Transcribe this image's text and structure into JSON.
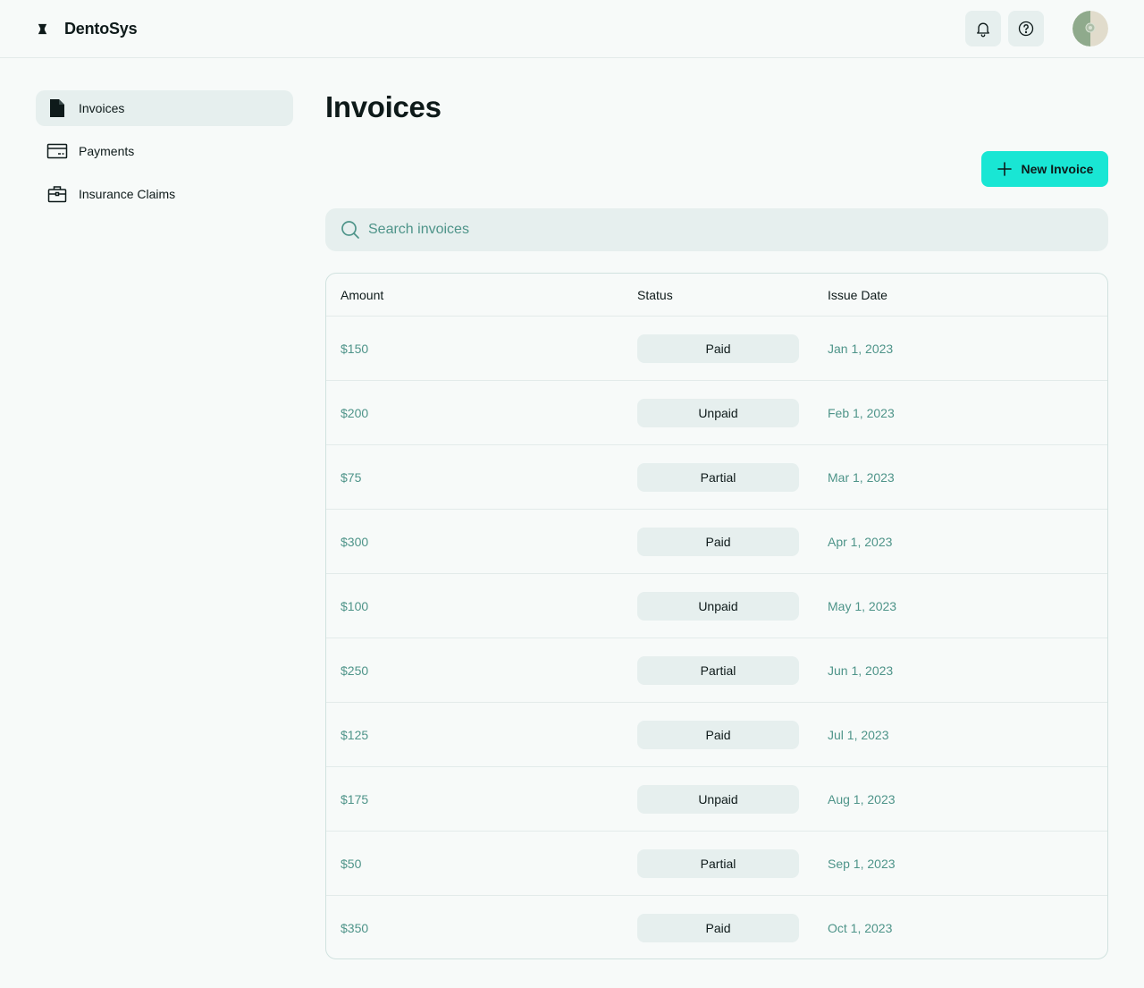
{
  "app": {
    "name": "DentoSys"
  },
  "header": {
    "icons": [
      "bell-icon",
      "help-circle-icon"
    ]
  },
  "sidebar": {
    "items": [
      {
        "label": "Invoices",
        "icon": "document-icon",
        "active": true
      },
      {
        "label": "Payments",
        "icon": "credit-card-icon",
        "active": false
      },
      {
        "label": "Insurance Claims",
        "icon": "briefcase-icon",
        "active": false
      }
    ]
  },
  "main": {
    "title": "Invoices",
    "new_button_label": "New Invoice",
    "search": {
      "placeholder": "Search invoices",
      "value": ""
    },
    "table": {
      "columns": [
        "Amount",
        "Status",
        "Issue Date"
      ],
      "rows": [
        {
          "amount": "$150",
          "status": "Paid",
          "date": "Jan 1, 2023"
        },
        {
          "amount": "$200",
          "status": "Unpaid",
          "date": "Feb 1, 2023"
        },
        {
          "amount": "$75",
          "status": "Partial",
          "date": "Mar 1, 2023"
        },
        {
          "amount": "$300",
          "status": "Paid",
          "date": "Apr 1, 2023"
        },
        {
          "amount": "$100",
          "status": "Unpaid",
          "date": "May 1, 2023"
        },
        {
          "amount": "$250",
          "status": "Partial",
          "date": "Jun 1, 2023"
        },
        {
          "amount": "$125",
          "status": "Paid",
          "date": "Jul 1, 2023"
        },
        {
          "amount": "$175",
          "status": "Unpaid",
          "date": "Aug 1, 2023"
        },
        {
          "amount": "$50",
          "status": "Partial",
          "date": "Sep 1, 2023"
        },
        {
          "amount": "$350",
          "status": "Paid",
          "date": "Oct 1, 2023"
        }
      ]
    }
  },
  "colors": {
    "background": "#f7faf9",
    "accent": "#19e6d4",
    "muted_text": "#4e9489",
    "surface": "#e6efee",
    "text": "#0e1a1a"
  }
}
